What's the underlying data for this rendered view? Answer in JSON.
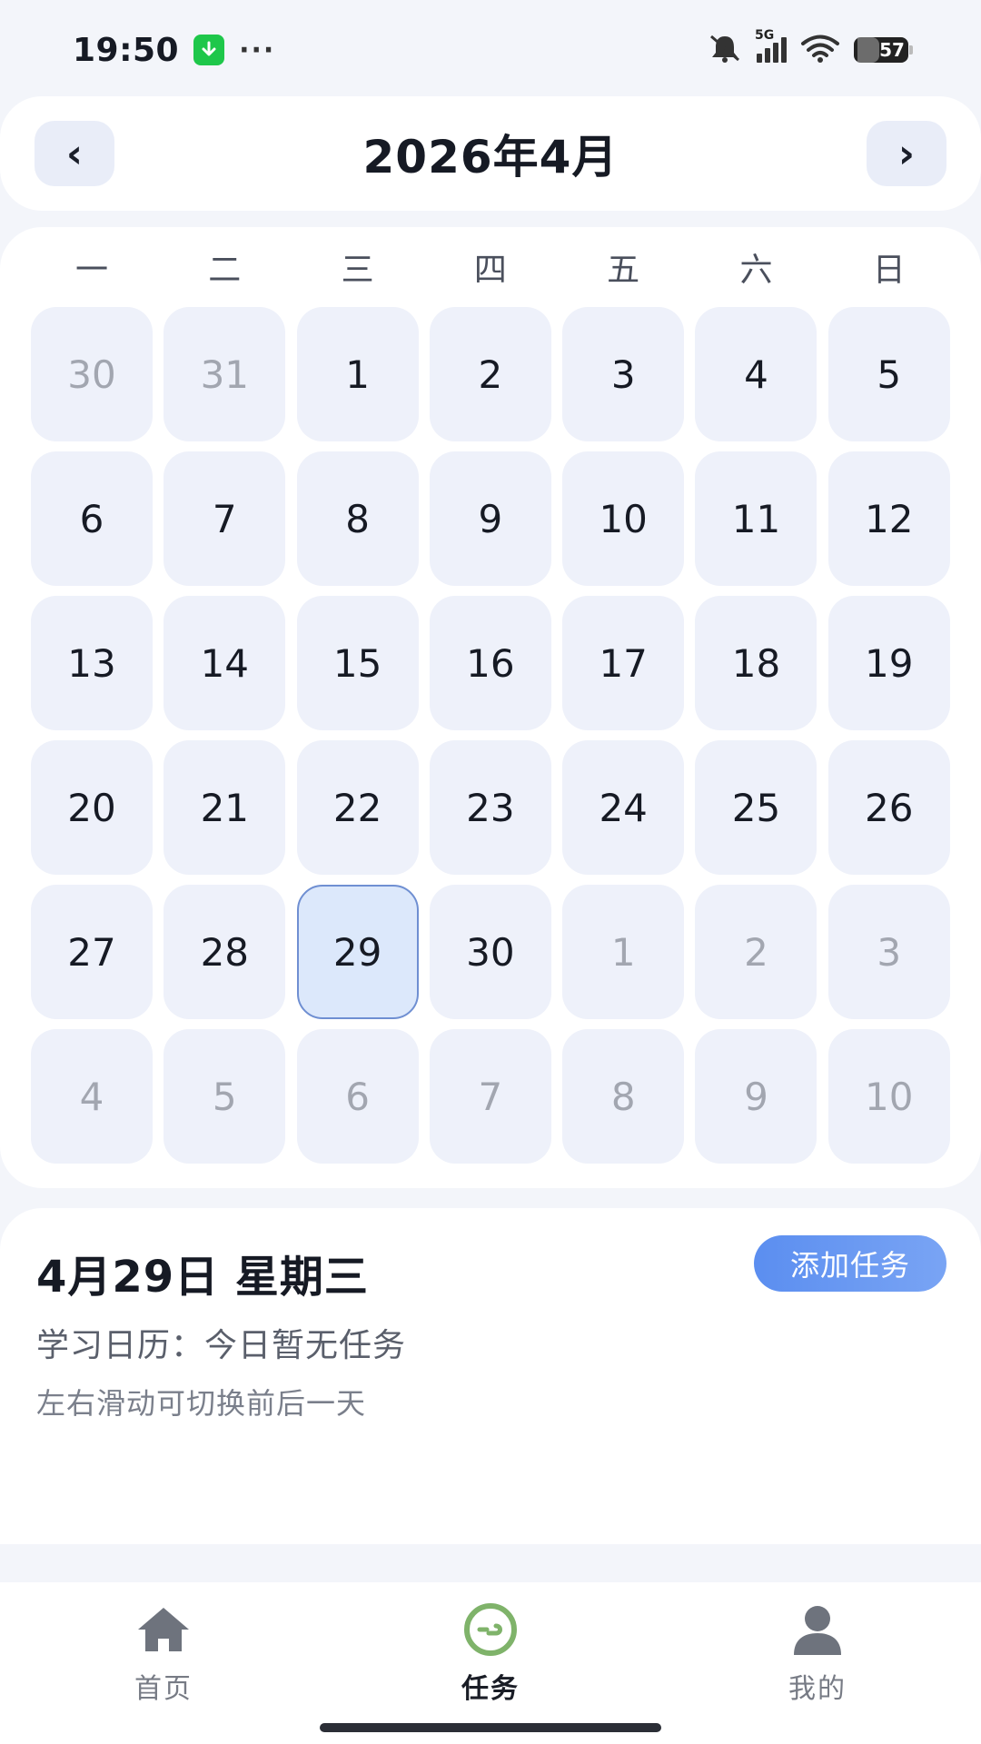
{
  "status_bar": {
    "time": "19:50",
    "dots": "···",
    "network": "5G",
    "battery": "57"
  },
  "header": {
    "prev_label": "‹",
    "next_label": "›",
    "title": "2026年4月"
  },
  "calendar": {
    "weekdays": [
      "一",
      "二",
      "三",
      "四",
      "五",
      "六",
      "日"
    ],
    "days": [
      {
        "label": "30",
        "muted": true
      },
      {
        "label": "31",
        "muted": true
      },
      {
        "label": "1"
      },
      {
        "label": "2"
      },
      {
        "label": "3"
      },
      {
        "label": "4"
      },
      {
        "label": "5"
      },
      {
        "label": "6"
      },
      {
        "label": "7"
      },
      {
        "label": "8"
      },
      {
        "label": "9"
      },
      {
        "label": "10"
      },
      {
        "label": "11"
      },
      {
        "label": "12"
      },
      {
        "label": "13"
      },
      {
        "label": "14"
      },
      {
        "label": "15"
      },
      {
        "label": "16"
      },
      {
        "label": "17"
      },
      {
        "label": "18"
      },
      {
        "label": "19"
      },
      {
        "label": "20"
      },
      {
        "label": "21"
      },
      {
        "label": "22"
      },
      {
        "label": "23"
      },
      {
        "label": "24"
      },
      {
        "label": "25"
      },
      {
        "label": "26"
      },
      {
        "label": "27"
      },
      {
        "label": "28"
      },
      {
        "label": "29",
        "selected": true
      },
      {
        "label": "30"
      },
      {
        "label": "1",
        "muted": true
      },
      {
        "label": "2",
        "muted": true
      },
      {
        "label": "3",
        "muted": true
      },
      {
        "label": "4",
        "muted": true
      },
      {
        "label": "5",
        "muted": true
      },
      {
        "label": "6",
        "muted": true
      },
      {
        "label": "7",
        "muted": true
      },
      {
        "label": "8",
        "muted": true
      },
      {
        "label": "9",
        "muted": true
      },
      {
        "label": "10",
        "muted": true
      }
    ]
  },
  "detail": {
    "date_title": "4月29日 星期三",
    "status_text": "学习日历：今日暂无任务",
    "hint_text": "左右滑动可切换前后一天",
    "add_button": "添加任务"
  },
  "bottom_nav": {
    "items": [
      {
        "label": "首页",
        "icon": "home-icon",
        "active": false
      },
      {
        "label": "任务",
        "icon": "task-icon",
        "active": true
      },
      {
        "label": "我的",
        "icon": "user-icon",
        "active": false
      }
    ]
  },
  "colors": {
    "accent": "#5b8ef0",
    "selected_bg": "#dce8fb",
    "selected_border": "#6f8fd2",
    "cell_bg": "#eef1fa",
    "active_tab_icon": "#7fb36a"
  }
}
